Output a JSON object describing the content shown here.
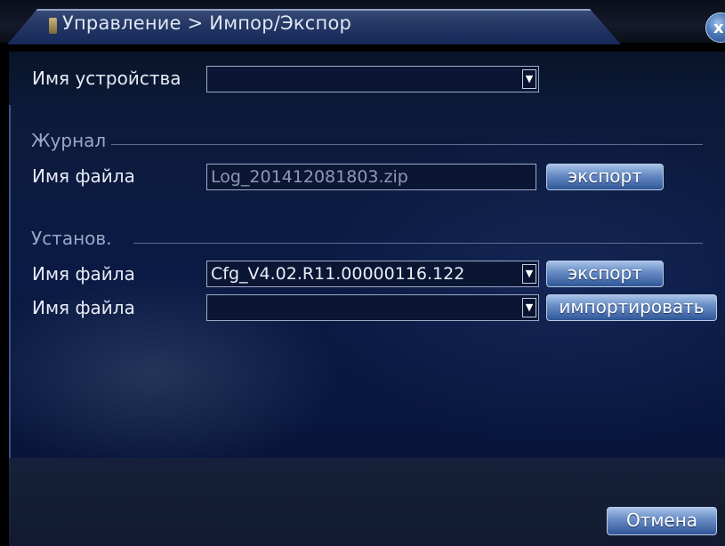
{
  "window": {
    "title": "Управление > Импор/Экспор",
    "close_glyph": "x"
  },
  "device": {
    "label": "Имя устройства",
    "value": ""
  },
  "log": {
    "section": "Журнал",
    "file_label": "Имя файла",
    "file_value": "Log_201412081803.zip",
    "export_label": "экспорт"
  },
  "config": {
    "section": "Установ.",
    "export_file_label": "Имя файла",
    "export_file_value": "Cfg_V4.02.R11.00000116.122",
    "export_label": "экспорт",
    "import_file_label": "Имя файла",
    "import_file_value": "",
    "import_label": "импортировать"
  },
  "footer": {
    "cancel_label": "Отмена"
  },
  "icons": {
    "title": "title-icon",
    "dropdown": "dropdown-arrow-icon",
    "close": "close-icon"
  },
  "colors": {
    "panel_bg": "#0a1a44",
    "button": "#6b8fc6",
    "title_tab": "#243764"
  }
}
